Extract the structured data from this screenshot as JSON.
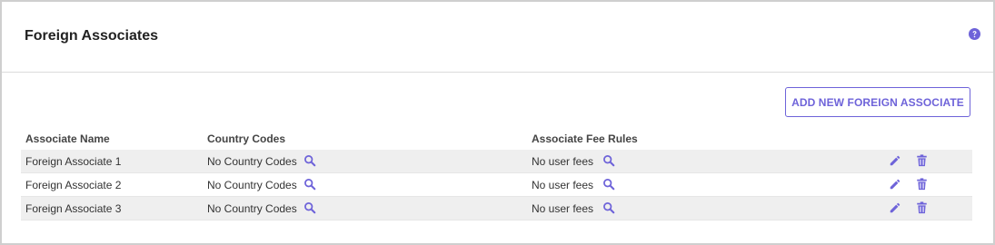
{
  "panel": {
    "title": "Foreign Associates",
    "help_icon": "question-circle-icon"
  },
  "toolbar": {
    "add_label": "ADD NEW FOREIGN ASSOCIATE"
  },
  "table": {
    "columns": [
      "Associate Name",
      "Country Codes",
      "Associate Fee Rules"
    ],
    "rows": [
      {
        "name": "Foreign Associate 1",
        "country_codes": "No Country Codes",
        "fee_rules": "No user fees"
      },
      {
        "name": "Foreign Associate 2",
        "country_codes": "No Country Codes",
        "fee_rules": "No user fees"
      },
      {
        "name": "Foreign Associate 3",
        "country_codes": "No Country Codes",
        "fee_rules": "No user fees"
      }
    ],
    "row_icons": {
      "search": "search-icon",
      "edit": "pencil-icon",
      "delete": "trash-icon"
    }
  },
  "colors": {
    "accent": "#6e63d9",
    "row_shade": "#efefef",
    "border": "#cfcfcf"
  }
}
